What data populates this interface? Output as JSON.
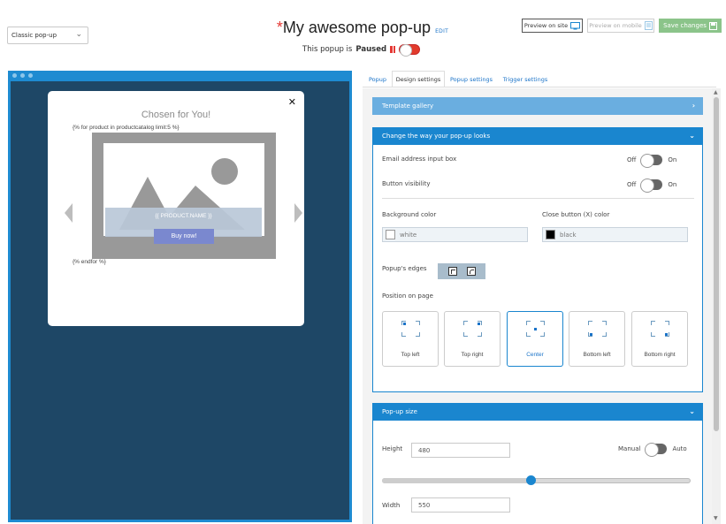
{
  "header": {
    "popup_type": "Classic pop-up",
    "title_marker": "*",
    "title": "My awesome pop-up",
    "edit_label": "EDIT",
    "status_prefix": "This popup is",
    "status_value": "Paused",
    "preview_site_label": "Preview on site",
    "preview_mobile_label": "Preview on mobile",
    "save_label": "Save changes"
  },
  "preview": {
    "heading": "Chosen for You!",
    "loop_open": "{% for product in productcatalog limit:5 %}",
    "loop_close": "{% endfor %}",
    "product_name": "{{ PRODUCT.NAME }}",
    "buy_button": "Buy now!",
    "close_glyph": "✕"
  },
  "tabs": [
    "Popup",
    "Design settings",
    "Popup settings",
    "Trigger settings"
  ],
  "active_tab": "Design settings",
  "panels": {
    "gallery": "Template gallery",
    "looks": "Change the way your pop-up looks",
    "size": "Pop-up size"
  },
  "looks": {
    "email_label": "Email address input box",
    "button_label": "Button visibility",
    "off_label": "Off",
    "on_label": "On",
    "bg_color_label": "Background color",
    "bg_color_value": "white",
    "close_color_label": "Close button (X) color",
    "close_color_value": "black",
    "edges_label": "Popup's edges",
    "position_label": "Position on page",
    "positions": [
      "Top left",
      "Top right",
      "Center",
      "Bottom left",
      "Bottom right"
    ],
    "selected_position": "Center"
  },
  "size": {
    "height_label": "Height",
    "height_value": "480",
    "manual_label": "Manual",
    "auto_label": "Auto",
    "width_label": "Width",
    "width_value": "550",
    "slider_fraction": 0.48
  },
  "colors": {
    "accent": "#1a86cf",
    "preview_bg": "#1e4766",
    "save_green": "#8bc48a",
    "paused_red": "#e53935"
  }
}
